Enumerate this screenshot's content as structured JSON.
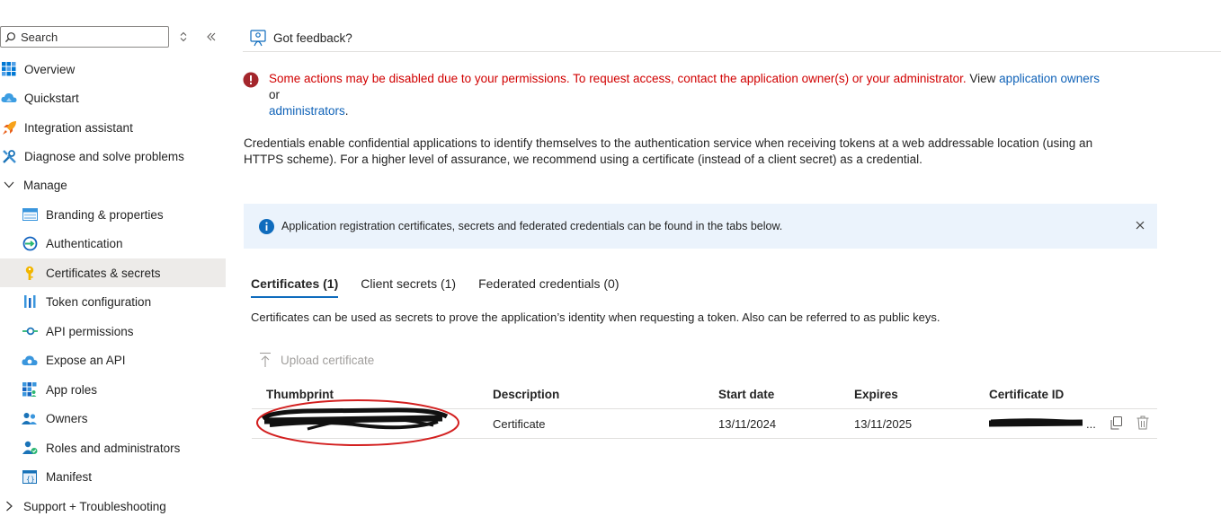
{
  "sidebar": {
    "search_placeholder": "Search",
    "items": [
      {
        "label": "Overview",
        "icon": "grid-icon"
      },
      {
        "label": "Quickstart",
        "icon": "cloud-icon"
      },
      {
        "label": "Integration assistant",
        "icon": "rocket-icon"
      },
      {
        "label": "Diagnose and solve problems",
        "icon": "wrench-icon"
      },
      {
        "label": "Manage",
        "icon": "chevron-down-icon"
      },
      {
        "label": "Branding & properties",
        "icon": "web-icon"
      },
      {
        "label": "Authentication",
        "icon": "auth-icon"
      },
      {
        "label": "Certificates & secrets",
        "icon": "key-icon"
      },
      {
        "label": "Token configuration",
        "icon": "bars-icon"
      },
      {
        "label": "API permissions",
        "icon": "api-icon"
      },
      {
        "label": "Expose an API",
        "icon": "cloud-api-icon"
      },
      {
        "label": "App roles",
        "icon": "apps-icon"
      },
      {
        "label": "Owners",
        "icon": "people-icon"
      },
      {
        "label": "Roles and administrators",
        "icon": "admin-icon"
      },
      {
        "label": "Manifest",
        "icon": "manifest-icon"
      },
      {
        "label": "Support + Troubleshooting",
        "icon": "chevron-right-icon"
      }
    ]
  },
  "command_bar": {
    "feedback_label": "Got feedback?"
  },
  "warning": {
    "text": "Some actions may be disabled due to your permissions. To request access, contact the application owner(s) or your administrator.",
    "view_text": " View ",
    "link1": "application owners",
    "or_text": " or ",
    "link2": "administrators",
    "end": "."
  },
  "description": "Credentials enable confidential applications to identify themselves to the authentication service when receiving tokens at a web addressable location (using an HTTPS scheme). For a higher level of assurance, we recommend using a certificate (instead of a client secret) as a credential.",
  "info_banner": "Application registration certificates, secrets and federated credentials can be found in the tabs below.",
  "tabs": [
    {
      "label": "Certificates (1)",
      "active": true
    },
    {
      "label": "Client secrets (1)",
      "active": false
    },
    {
      "label": "Federated credentials (0)",
      "active": false
    }
  ],
  "tab_note": "Certificates can be used as secrets to prove the application’s identity when requesting a token. Also can be referred to as public keys.",
  "upload_label": "Upload certificate",
  "table": {
    "columns": [
      "Thumbprint",
      "Description",
      "Start date",
      "Expires",
      "Certificate ID"
    ],
    "rows": [
      {
        "thumbprint": "",
        "description": "Certificate",
        "start_date": "13/11/2024",
        "expires": "13/11/2025",
        "certificate_id": "..."
      }
    ]
  },
  "colors": {
    "accent": "#0f6cbd",
    "error": "#d10000",
    "link": "#0f62b8",
    "info_bg": "#ebf3fc"
  }
}
